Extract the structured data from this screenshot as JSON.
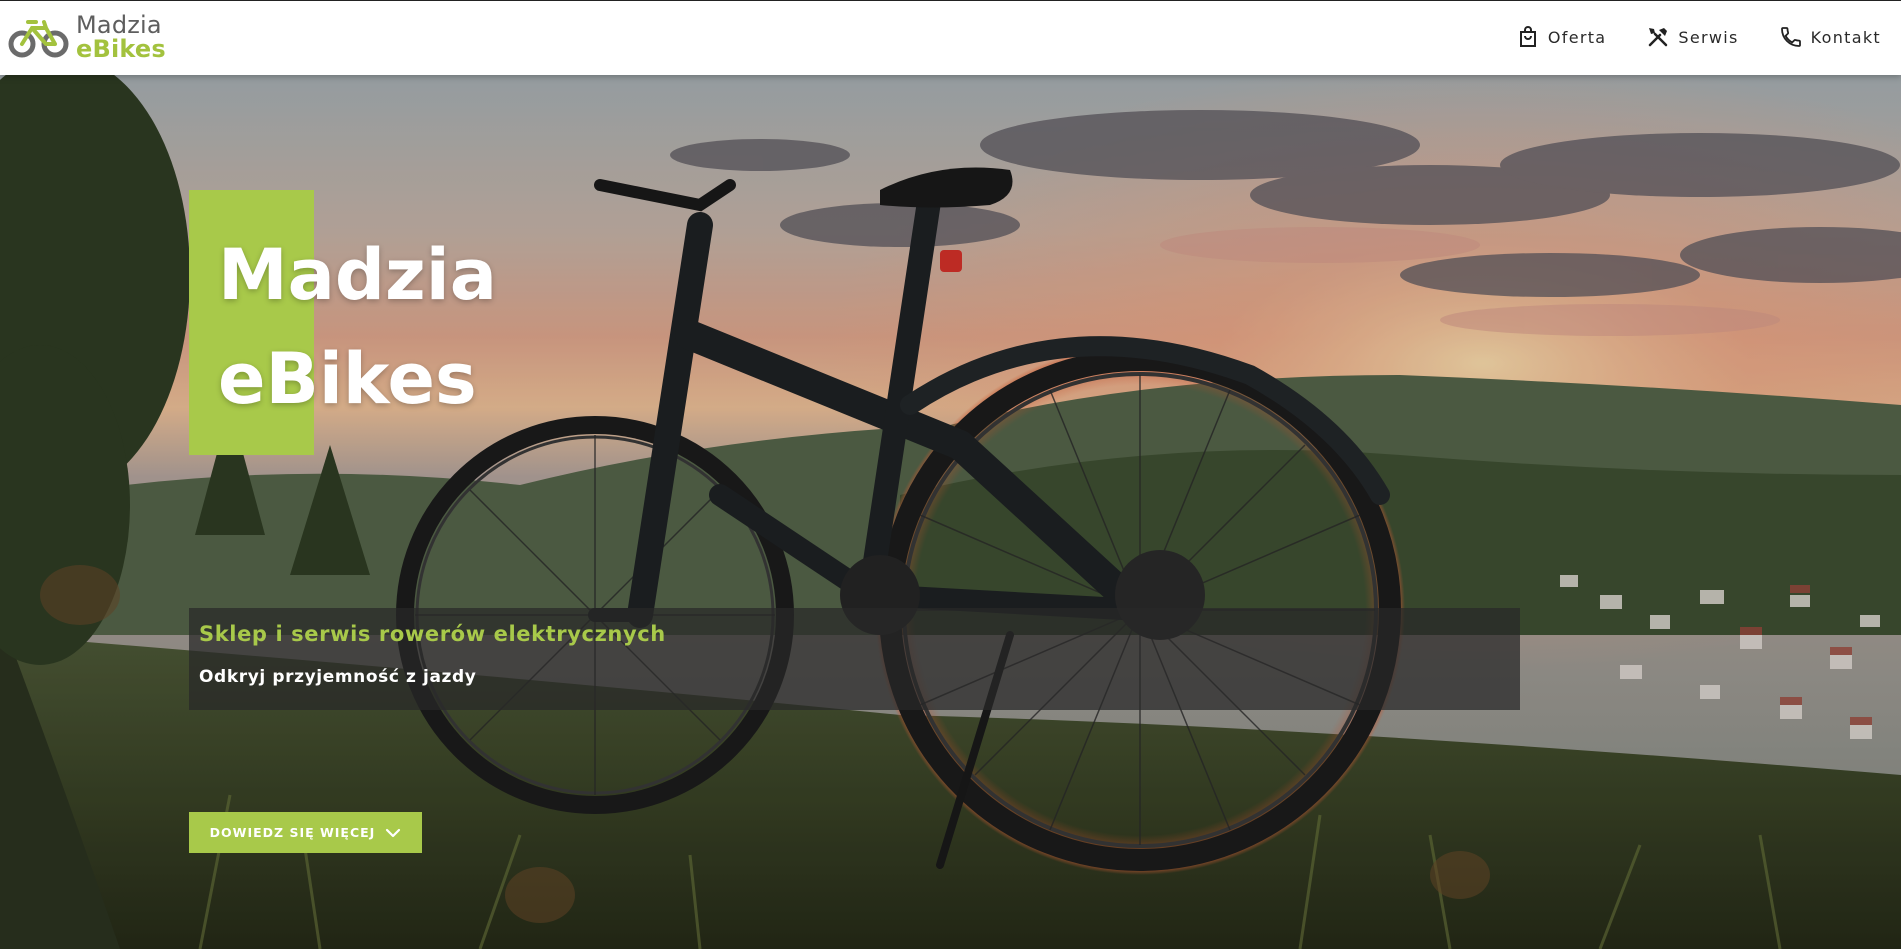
{
  "header": {
    "logo": {
      "line1": "Madzia",
      "line2": "eBikes",
      "icon": "bicycle-logo-icon"
    },
    "nav": [
      {
        "label": "Oferta",
        "icon": "shopping-bag-icon"
      },
      {
        "label": "Serwis",
        "icon": "tools-icon"
      },
      {
        "label": "Kontakt",
        "icon": "phone-icon"
      }
    ]
  },
  "hero": {
    "title_line1": "Madzia",
    "title_line2": "eBikes",
    "tagline": "Sklep i serwis rowerów elektrycznych",
    "subtagline": "Odkryj przyjemność z jazdy",
    "cta_label": "DOWIEDZ SIĘ WIĘCEJ",
    "cta_icon": "chevron-down-icon",
    "background": "e-bike-on-hill-at-sunset-photo"
  },
  "colors": {
    "brand_green": "#a8c94a",
    "logo_gray": "#5e5e5e",
    "header_bg": "#ffffff",
    "tagline_box": "rgba(40,40,40,0.72)"
  }
}
